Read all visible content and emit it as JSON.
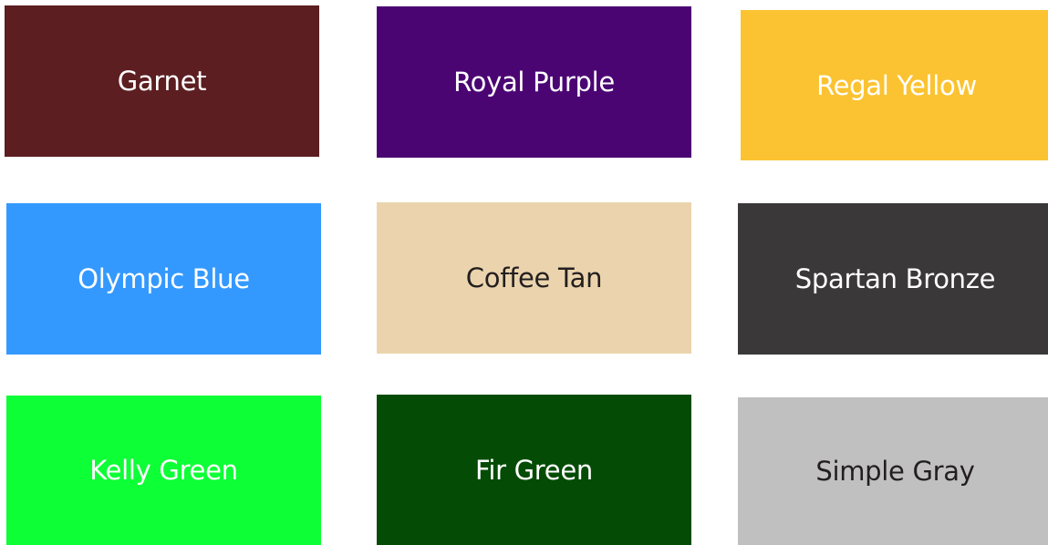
{
  "swatches": [
    {
      "label": "Garnet",
      "color": "#5c1e21",
      "text_color": "#ffffff"
    },
    {
      "label": "Royal Purple",
      "color": "#4b0573",
      "text_color": "#ffffff"
    },
    {
      "label": "Regal Yellow",
      "color": "#fbc332",
      "text_color": "#ffffff"
    },
    {
      "label": "Olympic Blue",
      "color": "#3499ff",
      "text_color": "#ffffff"
    },
    {
      "label": "Coffee Tan",
      "color": "#ebd4ad",
      "text_color": "#231f20"
    },
    {
      "label": "Spartan Bronze",
      "color": "#3a3839",
      "text_color": "#ffffff"
    },
    {
      "label": "Kelly Green",
      "color": "#0dff36",
      "text_color": "#ffffff"
    },
    {
      "label": "Fir Green",
      "color": "#044c05",
      "text_color": "#ffffff"
    },
    {
      "label": "Simple Gray",
      "color": "#c0c0c0",
      "text_color": "#231f20"
    }
  ]
}
